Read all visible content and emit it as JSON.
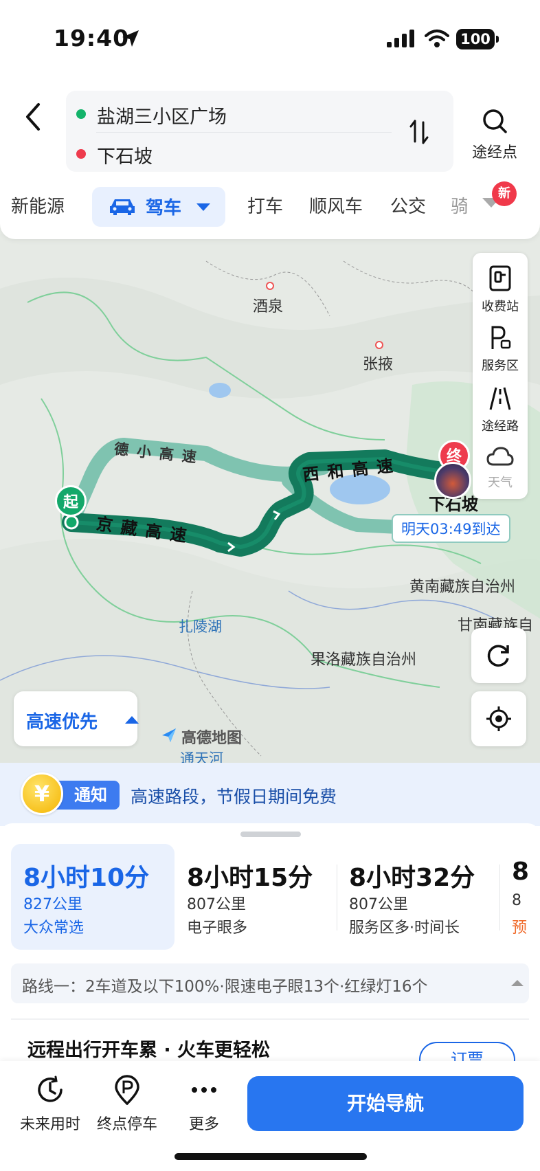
{
  "status_bar": {
    "time": "19:40",
    "battery": "100"
  },
  "search": {
    "origin": "盐湖三小区广场",
    "destination": "下石坡",
    "waypoint_label": "途经点"
  },
  "modes": {
    "items": [
      "新能源",
      "驾车",
      "打车",
      "顺风车",
      "公交",
      "骑"
    ],
    "active": "驾车",
    "new_badge": "新"
  },
  "map": {
    "places": [
      "酒泉",
      "张掖",
      "扎陵湖",
      "黄南藏族自治州",
      "甘南藏族自",
      "果洛藏族自治州",
      "通天河",
      "下石坡"
    ],
    "roads": [
      "京藏高速",
      "德小高速",
      "西和高速"
    ],
    "start_marker": "起",
    "end_marker": "终",
    "arrival": "明天03:49到达",
    "brand": "高德地图",
    "preference": "高速优先"
  },
  "map_tools": [
    {
      "label": "收费站",
      "icon": "toll-station-icon"
    },
    {
      "label": "服务区",
      "icon": "service-area-icon"
    },
    {
      "label": "途经路",
      "icon": "road-icon"
    },
    {
      "label": "天气",
      "icon": "weather-icon"
    }
  ],
  "notice": {
    "coin": "¥",
    "tag": "通知",
    "text": "高速路段，节假日期间免费"
  },
  "route_options": [
    {
      "duration": "8小时10分",
      "distance": "827公里",
      "tag": "大众常选",
      "selected": true
    },
    {
      "duration": "8小时15分",
      "distance": "807公里",
      "tag": "电子眼多",
      "selected": false
    },
    {
      "duration": "8小时32分",
      "distance": "807公里",
      "tag": "服务区多·时间长",
      "selected": false
    },
    {
      "duration": "8",
      "distance": "8",
      "tag": "预",
      "selected": false
    }
  ],
  "route_detail": "路线一：2车道及以下100%·限速电子眼13个·红绿灯16个",
  "promo": {
    "text": "远程出行开车累 · 火车更轻松",
    "button": "订票"
  },
  "bottom_bar": {
    "future_time": "未来用时",
    "parking": "终点停车",
    "more": "更多",
    "start_nav": "开始导航"
  },
  "colors": {
    "accent": "#2876f0",
    "route": "#137a5c",
    "alt_route": "#7fc3b0",
    "start": "#13a86a",
    "end": "#ee3b4d"
  }
}
